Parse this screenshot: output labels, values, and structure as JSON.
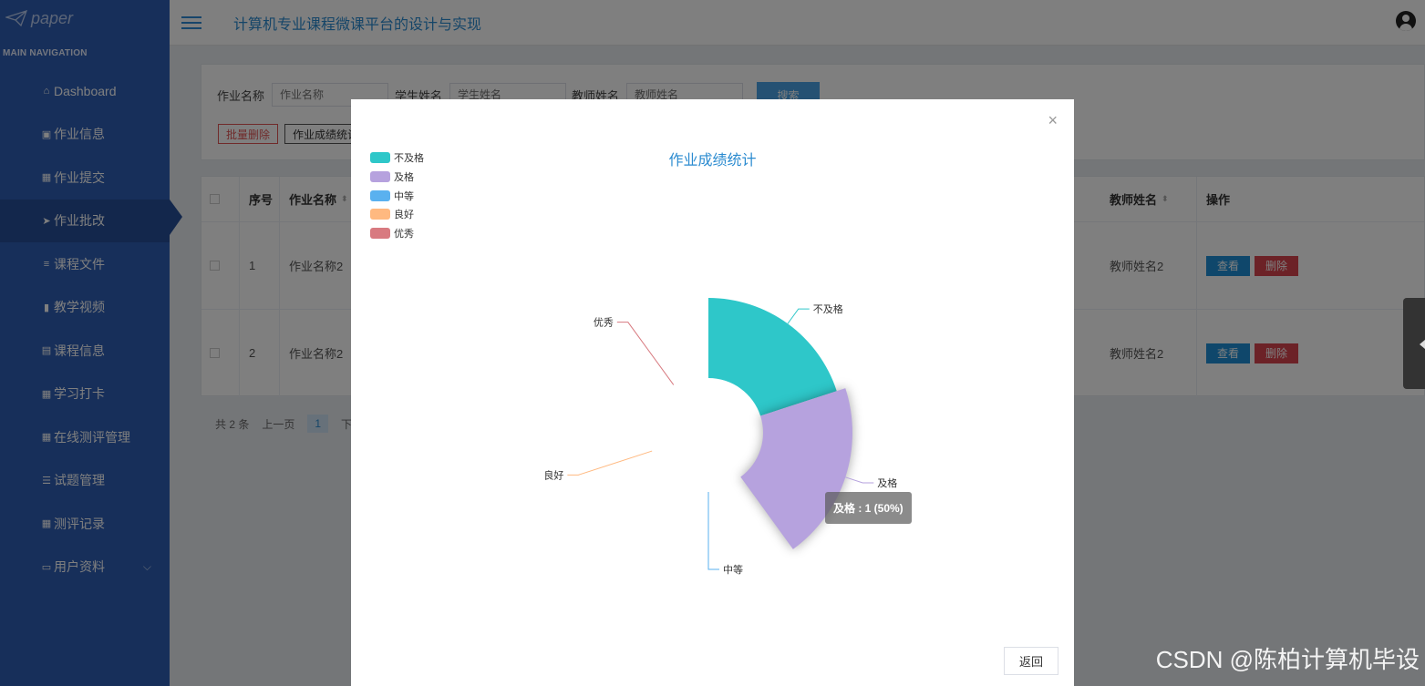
{
  "logo": {
    "text": "paper"
  },
  "nav": {
    "header": "MAIN NAVIGATION",
    "items": [
      {
        "label": "Dashboard",
        "icon": "home-icon",
        "glyph": "⌂"
      },
      {
        "label": "作业信息",
        "icon": "checkbox-icon",
        "glyph": "▣"
      },
      {
        "label": "作业提交",
        "icon": "grid-icon",
        "glyph": "▦"
      },
      {
        "label": "作业批改",
        "icon": "paper-plane-icon",
        "glyph": "➤"
      },
      {
        "label": "课程文件",
        "icon": "list-icon",
        "glyph": "≡"
      },
      {
        "label": "教学视频",
        "icon": "video-icon",
        "glyph": "▮"
      },
      {
        "label": "课程信息",
        "icon": "clipboard-icon",
        "glyph": "▤"
      },
      {
        "label": "学习打卡",
        "icon": "grid-icon",
        "glyph": "▦"
      },
      {
        "label": "在线测评管理",
        "icon": "grid-icon",
        "glyph": "▦"
      },
      {
        "label": "试题管理",
        "icon": "sliders-icon",
        "glyph": "☰"
      },
      {
        "label": "测评记录",
        "icon": "grid-icon",
        "glyph": "▦"
      },
      {
        "label": "用户资料",
        "icon": "id-card-icon",
        "glyph": "▭"
      }
    ],
    "active_index": 3,
    "chevron": "⌵"
  },
  "header": {
    "title": "计算机专业课程微课平台的设计与实现"
  },
  "search": {
    "hw_label": "作业名称",
    "hw_placeholder": "作业名称",
    "student_label": "学生姓名",
    "student_placeholder": "学生姓名",
    "teacher_label": "教师姓名",
    "teacher_placeholder": "教师姓名",
    "search_button": "搜索",
    "batch_delete": "批量删除",
    "stats_button": "作业成绩统计"
  },
  "table": {
    "headers": {
      "no": "序号",
      "name": "作业名称",
      "teacher": "教师姓名",
      "actions": "操作"
    },
    "rows": [
      {
        "no": "1",
        "name": "作业名称2",
        "teacher": "教师姓名2"
      },
      {
        "no": "2",
        "name": "作业名称2",
        "teacher": "教师姓名2"
      }
    ],
    "view_label": "查看",
    "delete_label": "删除"
  },
  "pager": {
    "total": "共 2 条",
    "prev": "上一页",
    "page": "1",
    "next": "下"
  },
  "modal": {
    "close": "×",
    "back_button": "返回",
    "tooltip": "及格 : 1 (50%)"
  },
  "chart_data": {
    "type": "pie",
    "subtype": "rose",
    "title": "作业成绩统计",
    "legend_position": "top-left",
    "categories": [
      "不及格",
      "及格",
      "中等",
      "良好",
      "优秀"
    ],
    "values": [
      1,
      1,
      0,
      0,
      0
    ],
    "colors": [
      "#2ec7c9",
      "#b6a2de",
      "#5ab1ef",
      "#ffb980",
      "#d87a80"
    ],
    "highlighted": "及格"
  },
  "watermark": "CSDN @陈柏计算机毕设"
}
